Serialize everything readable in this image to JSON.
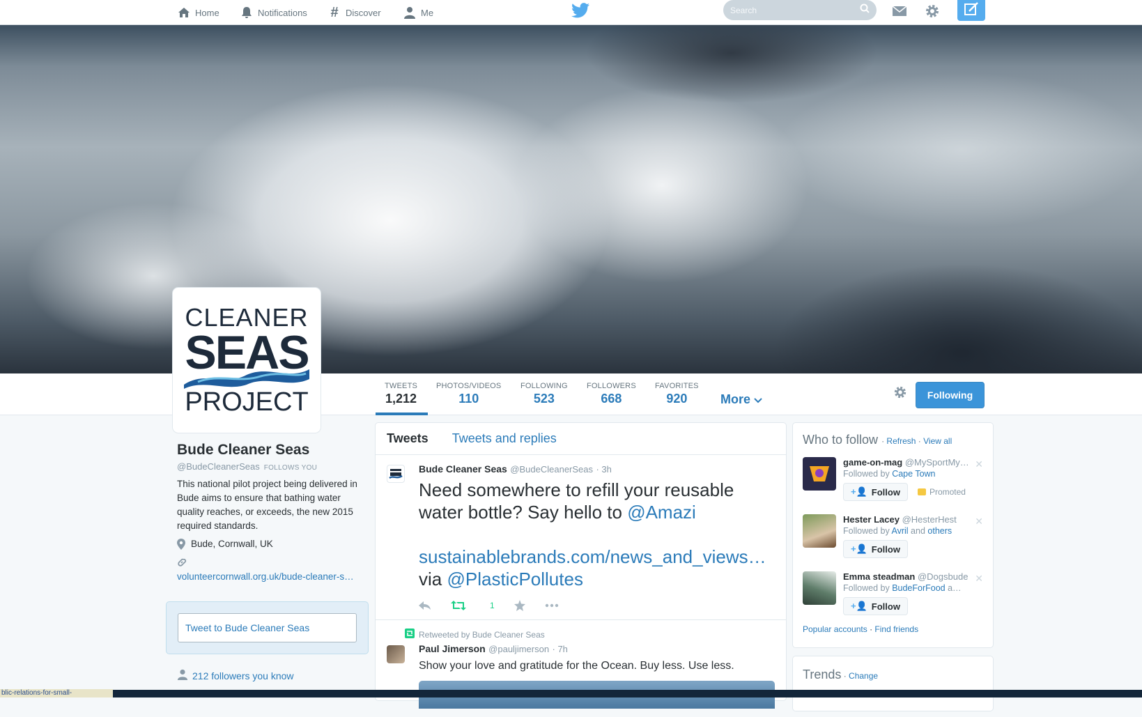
{
  "nav": {
    "home": "Home",
    "notifications": "Notifications",
    "discover": "Discover",
    "me": "Me",
    "search_placeholder": "Search"
  },
  "colors": {
    "accent": "#55acee",
    "link": "#2b7bb9",
    "retweet_green": "#19cf86"
  },
  "avatar_logo": {
    "line1": "CLEANER",
    "line2": "SEAS",
    "line3": "PROJECT"
  },
  "stats": [
    {
      "label": "TWEETS",
      "value": "1,212"
    },
    {
      "label": "PHOTOS/VIDEOS",
      "value": "110"
    },
    {
      "label": "FOLLOWING",
      "value": "523"
    },
    {
      "label": "FOLLOWERS",
      "value": "668"
    },
    {
      "label": "FAVORITES",
      "value": "920"
    }
  ],
  "more_label": "More",
  "following_button": "Following",
  "profile": {
    "name": "Bude Cleaner Seas",
    "handle": "@BudeCleanerSeas",
    "follows_you": "FOLLOWS YOU",
    "bio": "This national pilot project being delivered in Bude aims to ensure that bathing water quality reaches, or exceeds, the new 2015 required standards.",
    "location": "Bude, Cornwall, UK",
    "url": "volunteercornwall.org.uk/bude-cleaner-s…",
    "tweet_to": "Tweet to Bude Cleaner Seas",
    "followers_you_know": "212 followers you know"
  },
  "timeline": {
    "tabs": [
      "Tweets",
      "Tweets and replies"
    ],
    "tweets": [
      {
        "name": "Bude Cleaner Seas",
        "handle": "@BudeCleanerSeas",
        "time": "· 3h",
        "text_a": "Need somewhere to refill your reusable water bottle? Say hello to ",
        "mention": "@Amazi",
        "link": "sustainablebrands.com/news_and_views…",
        "via": " via",
        "mention2": "@PlasticPollutes",
        "retweets": "1"
      },
      {
        "retweeted_by": "Retweeted by Bude Cleaner Seas",
        "name": "Paul Jimerson",
        "handle": "@pauljimerson",
        "time": "· 7h",
        "text": "Show your love and gratitude for the Ocean. Buy less. Use less."
      }
    ]
  },
  "who_to_follow": {
    "title": "Who to follow",
    "refresh": "Refresh",
    "view_all": "View all",
    "suggestions": [
      {
        "name": "game-on-mag",
        "handle": "@MySportMy…",
        "followed_prefix": "Followed by ",
        "followed_by": "Cape Town",
        "followed_suffix": "",
        "promoted": "Promoted",
        "follow": "Follow"
      },
      {
        "name": "Hester Lacey",
        "handle": "@HesterHest",
        "followed_prefix": "Followed by ",
        "followed_by": "Avril",
        "followed_suffix": " and ",
        "others": "others",
        "follow": "Follow"
      },
      {
        "name": "Emma steadman",
        "handle": "@Dogsbude",
        "followed_prefix": "Followed by ",
        "followed_by": "BudeForFood",
        "followed_suffix": " a…",
        "follow": "Follow"
      }
    ],
    "popular": "Popular accounts",
    "find_friends": "Find friends"
  },
  "trends": {
    "title": "Trends",
    "change": "Change"
  },
  "status_url": "blic-relations-for-small-"
}
